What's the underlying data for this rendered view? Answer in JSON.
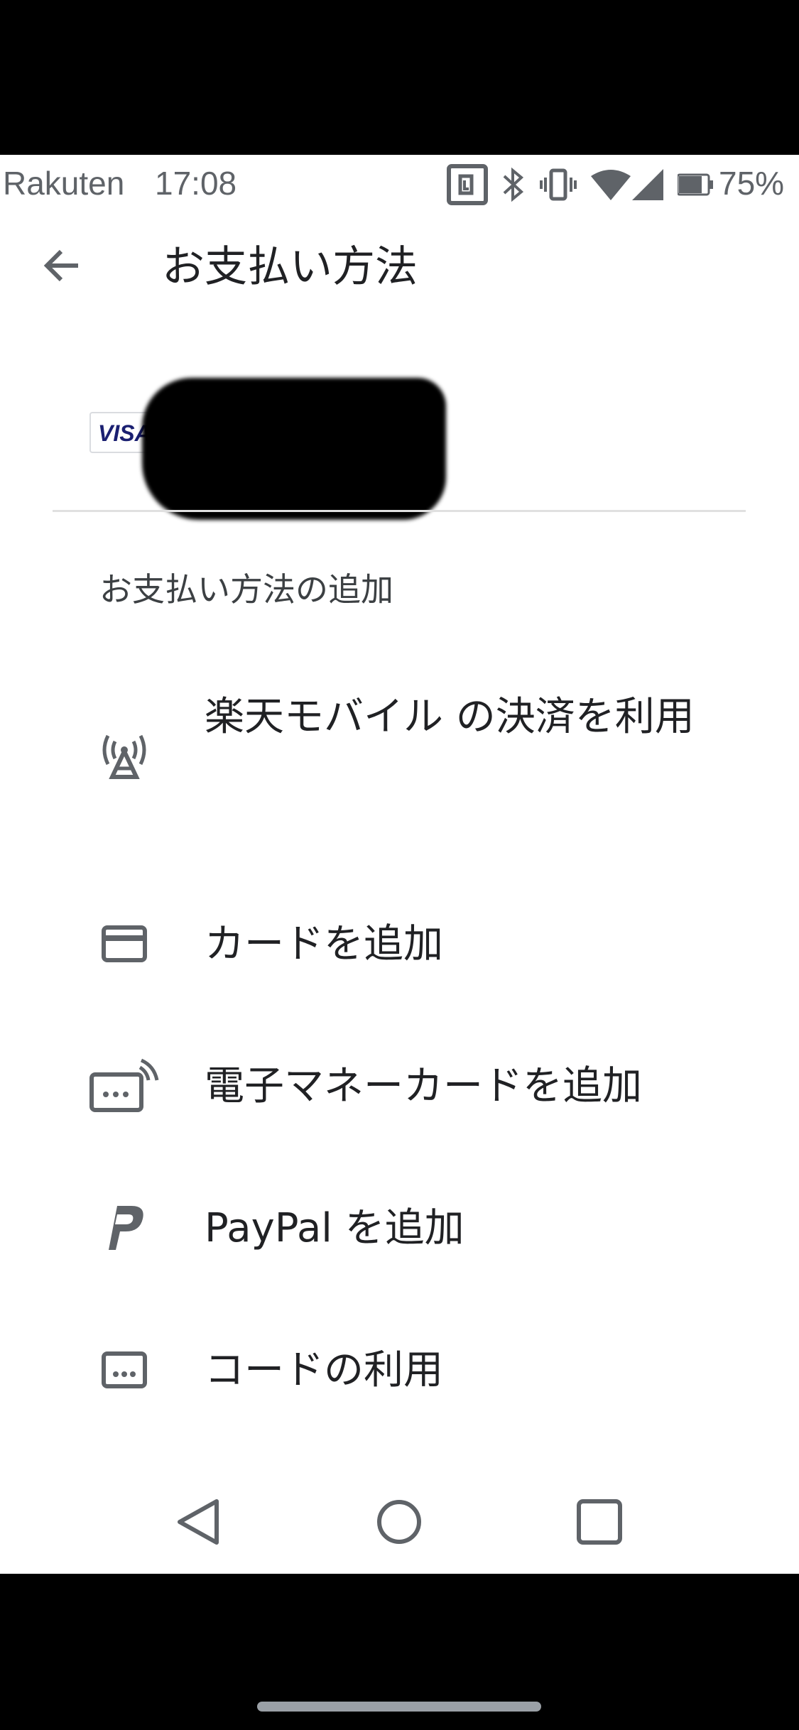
{
  "status_bar": {
    "carrier": "Rakuten",
    "time": "17:08",
    "battery": "75%"
  },
  "app_bar": {
    "title": "お支払い方法"
  },
  "saved_payment": {
    "card_brand": "VISA"
  },
  "add_section": {
    "header": "お支払い方法の追加",
    "items": [
      {
        "label": "楽天モバイル の決済を利用",
        "icon": "carrier-billing-icon"
      },
      {
        "label": "カードを追加",
        "icon": "credit-card-icon"
      },
      {
        "label": "電子マネーカードを追加",
        "icon": "e-money-card-icon"
      },
      {
        "label": "PayPal を追加",
        "icon": "paypal-icon"
      },
      {
        "label": "コードの利用",
        "icon": "redeem-code-icon"
      }
    ]
  },
  "colors": {
    "icon": "#5f6368",
    "text": "#202124",
    "visa": "#1a1f71"
  }
}
